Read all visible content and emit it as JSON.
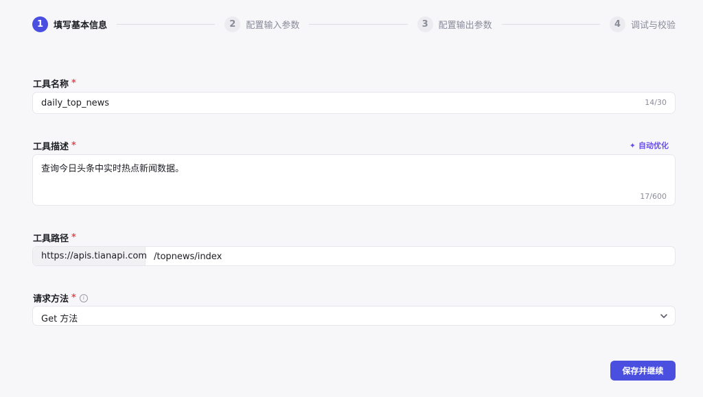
{
  "stepper": {
    "steps": [
      {
        "num": "1",
        "label": "填写基本信息",
        "active": true
      },
      {
        "num": "2",
        "label": "配置输入参数",
        "active": false
      },
      {
        "num": "3",
        "label": "配置输出参数",
        "active": false
      },
      {
        "num": "4",
        "label": "调试与校验",
        "active": false
      }
    ]
  },
  "form": {
    "tool_name": {
      "label": "工具名称",
      "required": "*",
      "value": "daily_top_news",
      "counter": "14/30"
    },
    "tool_desc": {
      "label": "工具描述",
      "required": "*",
      "value": "查询今日头条中实时热点新闻数据。",
      "counter": "17/600",
      "auto_optimize": "自动优化"
    },
    "tool_path": {
      "label": "工具路径",
      "required": "*",
      "prefix": "https://apis.tianapi.com",
      "value": "/topnews/index"
    },
    "method": {
      "label": "请求方法",
      "required": "*",
      "info": "i",
      "value": "Get 方法"
    }
  },
  "actions": {
    "save_continue": "保存并继续"
  },
  "colors": {
    "accent": "#4b4fe0",
    "required": "#e5484d",
    "ai": "#6a4ee8"
  }
}
